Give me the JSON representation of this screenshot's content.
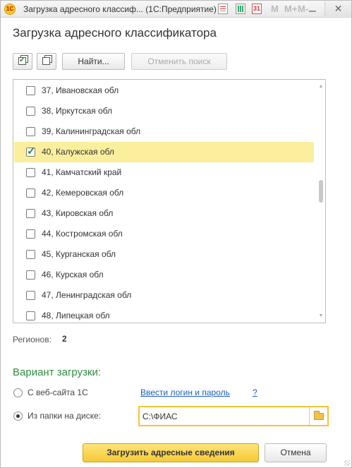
{
  "titlebar": {
    "app_logo": "1С",
    "title": "Загрузка адресного классиф...  (1С:Предприятие)",
    "calendar_day": "31",
    "m_buttons": [
      "M",
      "M+",
      "M-"
    ],
    "close_symbol": "✕"
  },
  "form": {
    "title": "Загрузка адресного классификатора"
  },
  "toolbar": {
    "find_label": "Найти...",
    "cancel_search_label": "Отменить поиск"
  },
  "regions": [
    {
      "label": "37, Ивановская обл",
      "checked": false
    },
    {
      "label": "38, Иркутская обл",
      "checked": false
    },
    {
      "label": "39, Калининградская обл",
      "checked": false
    },
    {
      "label": "40, Калужская обл",
      "checked": true,
      "selected": true
    },
    {
      "label": "41, Камчатский край",
      "checked": false
    },
    {
      "label": "42, Кемеровская обл",
      "checked": false
    },
    {
      "label": "43, Кировская обл",
      "checked": false
    },
    {
      "label": "44, Костромская обл",
      "checked": false
    },
    {
      "label": "45, Курганская обл",
      "checked": false
    },
    {
      "label": "46, Курская обл",
      "checked": false
    },
    {
      "label": "47, Ленинградская обл",
      "checked": false
    },
    {
      "label": "48, Липецкая обл",
      "checked": false
    }
  ],
  "summary": {
    "regions_label": "Регионов:",
    "regions_count": "2"
  },
  "load_variant": {
    "title": "Вариант загрузки:",
    "option_web": "С веб-сайта 1С",
    "login_link": "Ввести логин и пароль",
    "help_link": "?",
    "option_folder": "Из папки на диске:",
    "folder_path": "C:\\ФИАС",
    "selected": "folder"
  },
  "buttons": {
    "load": "Загрузить адресные сведения",
    "cancel": "Отмена"
  },
  "colors": {
    "accent_yellow": "#f5c936",
    "selected_row": "#fbef9e",
    "section_green": "#2e8f3e",
    "link_blue": "#1b5fb5"
  }
}
